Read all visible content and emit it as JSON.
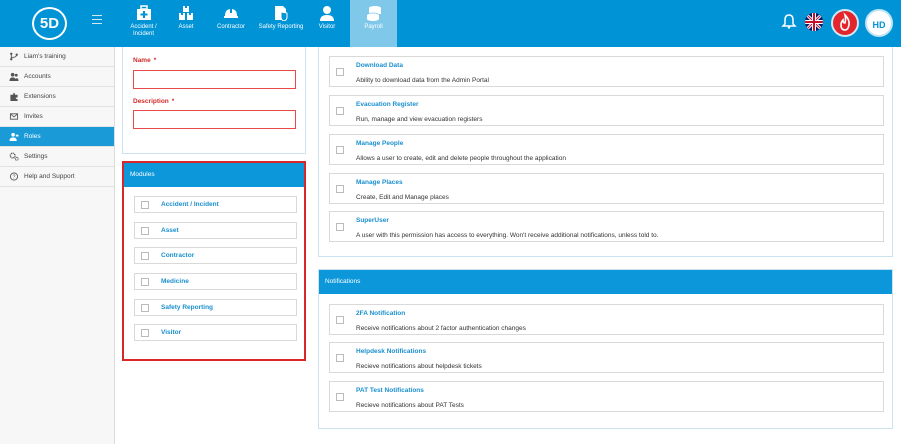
{
  "app": {
    "logo_text": "5D",
    "brand_color": "#0093d6",
    "accent_red": "#d9262a"
  },
  "topnav": {
    "tabs": [
      {
        "label": "Accident / Incident",
        "icon": "first-aid-kit-icon"
      },
      {
        "label": "Asset",
        "icon": "boxes-icon"
      },
      {
        "label": "Contractor",
        "icon": "hard-hat-icon"
      },
      {
        "label": "Safety Reporting",
        "icon": "shield-report-icon"
      },
      {
        "label": "Visitor",
        "icon": "person-icon"
      },
      {
        "label": "Payroll",
        "icon": "coins-icon",
        "active": true
      }
    ],
    "avatar_initials": "HD"
  },
  "sidebar": {
    "items": [
      {
        "label": "Liam's training",
        "icon": "branch-icon"
      },
      {
        "label": "Accounts",
        "icon": "users-icon"
      },
      {
        "label": "Extensions",
        "icon": "puzzle-icon"
      },
      {
        "label": "Invites",
        "icon": "envelope-icon"
      },
      {
        "label": "Roles",
        "icon": "user-role-icon",
        "active": true
      },
      {
        "label": "Settings",
        "icon": "gears-icon"
      },
      {
        "label": "Help and Support",
        "icon": "question-icon"
      }
    ]
  },
  "form": {
    "name_label": "Name",
    "description_label": "Description",
    "required_mark": "*",
    "name_value": "",
    "description_value": ""
  },
  "modules": {
    "title": "Modules",
    "items": [
      "Accident / Incident",
      "Asset",
      "Contractor",
      "Medicine",
      "Safety Reporting",
      "Visitor"
    ]
  },
  "permissions": {
    "items": [
      {
        "title": "Download Data",
        "desc": "Ability to download data from the Admin Portal"
      },
      {
        "title": "Evacuation Register",
        "desc": "Run, manage and view evacuation registers"
      },
      {
        "title": "Manage People",
        "desc": "Allows a user to create, edit and delete people throughout the application"
      },
      {
        "title": "Manage Places",
        "desc": "Create, Edit and Manage places"
      },
      {
        "title": "SuperUser",
        "desc": "A user with this permission has access to everything. Won't receive additional notifications, unless told to."
      }
    ]
  },
  "notifications": {
    "title": "Notifications",
    "items": [
      {
        "title": "2FA Notification",
        "desc": "Receive notifications about 2 factor authentication changes"
      },
      {
        "title": "Helpdesk Notifications",
        "desc": "Recieve notifications about helpdesk tickets"
      },
      {
        "title": "PAT Test Notifications",
        "desc": "Recieve notifications about PAT Tests"
      }
    ]
  }
}
